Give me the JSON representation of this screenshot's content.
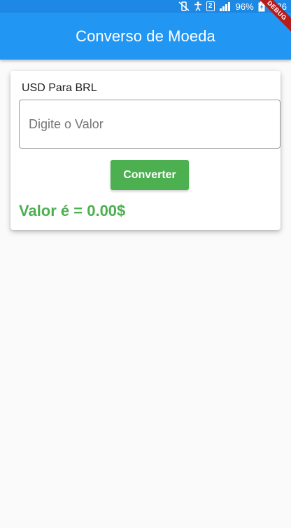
{
  "status_bar": {
    "sim_label": "2",
    "battery_percent": "96%",
    "time": "1:26"
  },
  "app_bar": {
    "title": "Converso de Moeda"
  },
  "debug_banner": {
    "label": "DEBUG"
  },
  "card": {
    "heading": "USD Para BRL",
    "input_placeholder": "Digite o Valor",
    "input_value": "",
    "button_label": "Converter",
    "result_text": "Valor é = 0.00$"
  },
  "colors": {
    "app_bar": "#2196f3",
    "status_bar": "#1e88e5",
    "accent_green": "#4caf50",
    "debug_red": "#b71c1c"
  }
}
